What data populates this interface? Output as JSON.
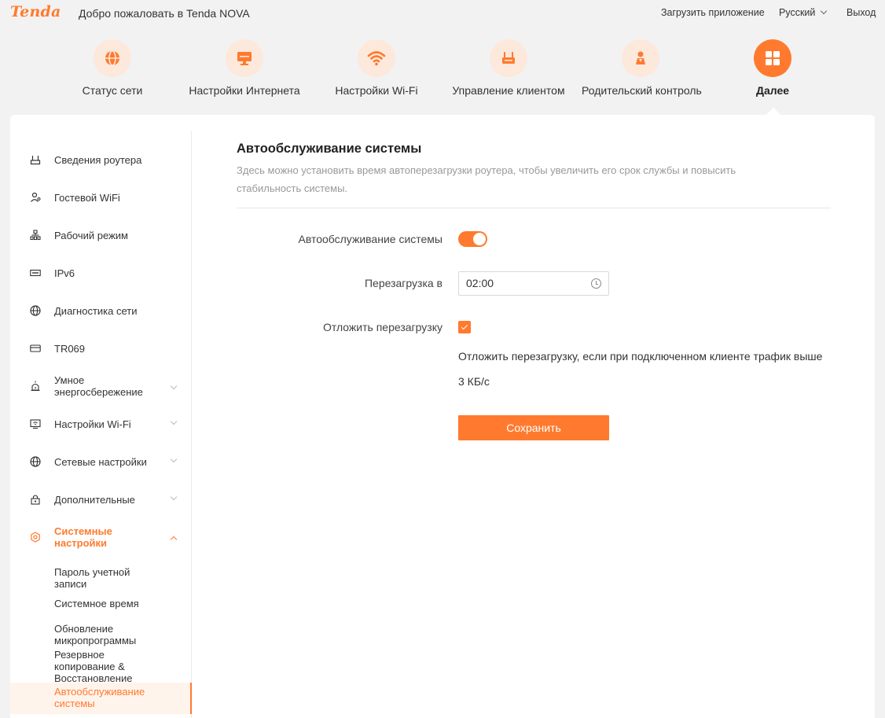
{
  "header": {
    "logo": "Tenda",
    "welcome": "Добро пожаловать в Tenda NOVA",
    "download_app": "Загрузить приложение",
    "language": "Русский",
    "logout": "Выход"
  },
  "nav": [
    {
      "label": "Статус сети",
      "icon": "globe-icon"
    },
    {
      "label": "Настройки Интернета",
      "icon": "monitor-icon"
    },
    {
      "label": "Настройки Wi-Fi",
      "icon": "wifi-icon"
    },
    {
      "label": "Управление клиентом",
      "icon": "router-icon"
    },
    {
      "label": "Родительский контроль",
      "icon": "parental-icon"
    },
    {
      "label": "Далее",
      "icon": "grid-icon",
      "active": true
    }
  ],
  "sidebar": {
    "items": [
      {
        "label": "Сведения роутера",
        "icon": "router-info-icon"
      },
      {
        "label": "Гостевой WiFi",
        "icon": "guest-icon"
      },
      {
        "label": "Рабочий режим",
        "icon": "network-mode-icon"
      },
      {
        "label": "IPv6",
        "icon": "ipv6-icon"
      },
      {
        "label": "Диагностика сети",
        "icon": "globe-icon"
      },
      {
        "label": "TR069",
        "icon": "tr069-icon"
      },
      {
        "label": "Умное энергосбережение",
        "icon": "alarm-icon"
      },
      {
        "label": "Настройки Wi-Fi",
        "icon": "wifi-settings-icon"
      },
      {
        "label": "Сетевые настройки",
        "icon": "globe-icon"
      },
      {
        "label": "Дополнительные",
        "icon": "lock-icon"
      },
      {
        "label": "Системные настройки",
        "icon": "settings-icon"
      }
    ],
    "sub_items": [
      {
        "label": "Пароль учетной записи"
      },
      {
        "label": "Системное время"
      },
      {
        "label": "Обновление микропрограммы"
      },
      {
        "label": "Резервное копирование & Восстановление"
      },
      {
        "label": "Автообслуживание системы"
      }
    ]
  },
  "main": {
    "title": "Автообслуживание системы",
    "description": "Здесь можно установить время автоперезагрузки роутера, чтобы увеличить его срок службы и повысить стабильность системы.",
    "auto_label": "Автообслуживание системы",
    "auto_enabled": true,
    "reboot_label": "Перезагрузка в",
    "reboot_time": "02:00",
    "delay_label": "Отложить перезагрузку",
    "delay_checked": true,
    "delay_note_line1": "Отложить перезагрузку, если при подключенном клиенте трафик выше",
    "delay_note_line2": "3 КБ/с",
    "save": "Сохранить"
  },
  "colors": {
    "accent": "#ff7a2e",
    "accent_light": "#fde8dc"
  }
}
